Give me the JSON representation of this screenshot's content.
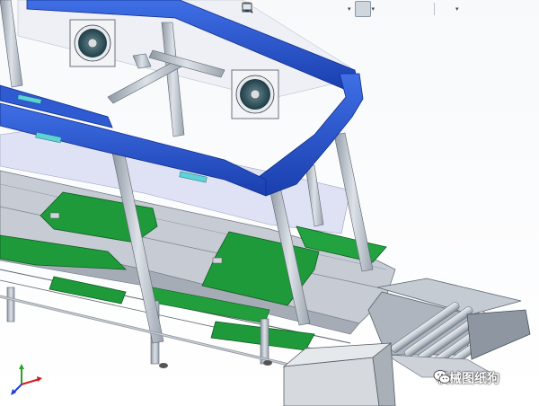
{
  "window": {
    "type": "3d-cad-graphics-viewport"
  },
  "heads_up_toolbar": {
    "items": [
      {
        "icon": "zoom-to-fit-icon"
      },
      {
        "icon": "zoom-to-area-icon"
      },
      {
        "icon": "previous-view-icon"
      },
      {
        "icon": "section-view-icon"
      },
      {
        "icon": "dynamic-annotation-icon"
      },
      {
        "icon": "view-orientation-icon"
      },
      {
        "icon": "display-style-icon",
        "active": true
      },
      {
        "icon": "hide-show-items-icon"
      },
      {
        "icon": "edit-appearance-icon"
      },
      {
        "icon": "apply-scene-icon"
      },
      {
        "icon": "view-settings-icon"
      }
    ]
  },
  "watermark": {
    "text": "机械图纸狗",
    "icon": "wechat-logo-icon"
  },
  "triad": {
    "axes": [
      "x",
      "y",
      "z"
    ],
    "colors": {
      "x": "#d11c1c",
      "y": "#2aa02a",
      "z": "#1f3fd6"
    }
  },
  "model_colors": {
    "frame_blue": "#1f4fc8",
    "board_green": "#1f9a3a",
    "steel_gray": "#b9c0c9",
    "background": "#ffffff"
  }
}
